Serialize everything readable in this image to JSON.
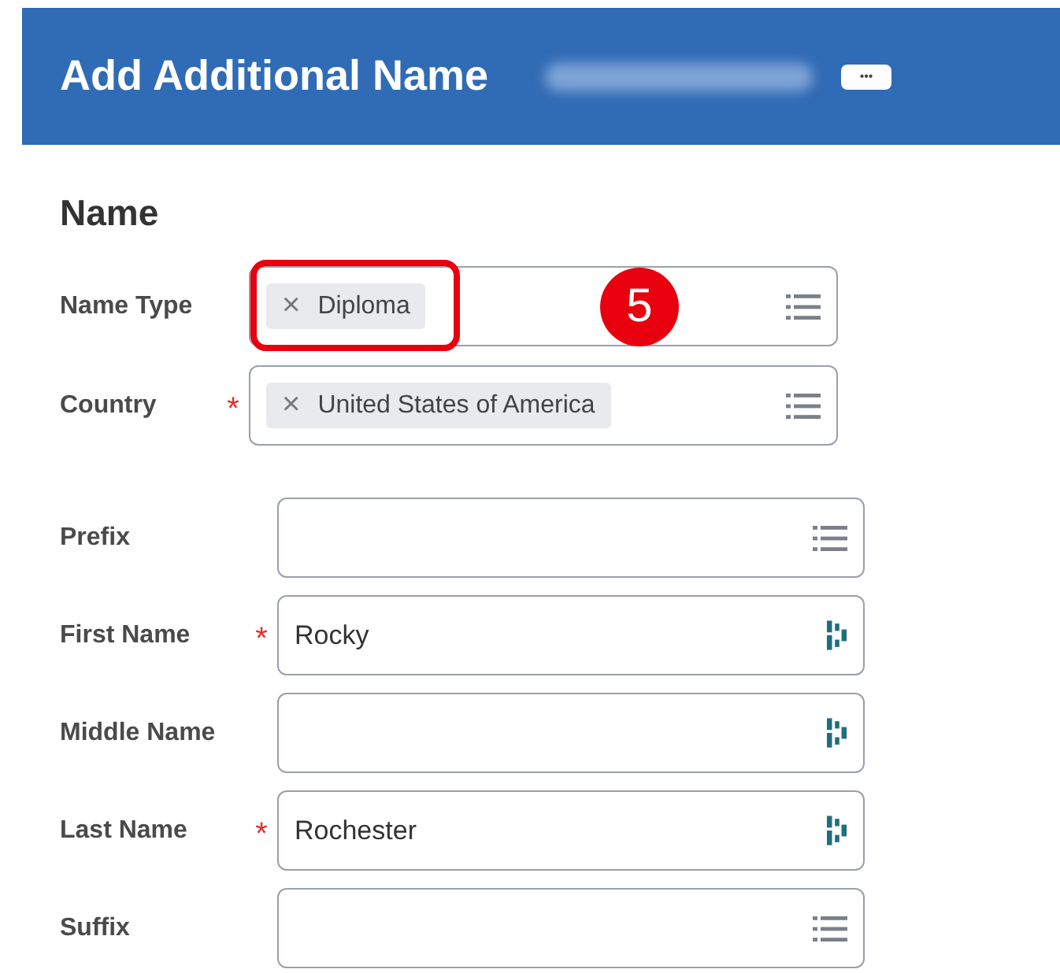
{
  "header": {
    "title": "Add Additional Name",
    "subtitle_redacted": true,
    "more_button": "•••"
  },
  "section_title": "Name",
  "field_groups": [
    [
      {
        "label": "Name Type",
        "kind": "select",
        "chips": [
          {
            "text": "Diploma",
            "remove": "×",
            "highlighted": true
          }
        ],
        "callout": "5"
      },
      {
        "label": "Country",
        "required_mark": "*",
        "kind": "select",
        "chips": [
          {
            "text": "United States of America",
            "remove": "×",
            "highlighted": false
          }
        ]
      }
    ],
    [
      {
        "label": "Prefix",
        "kind": "select"
      },
      {
        "label": "First Name",
        "required_mark": "*",
        "kind": "text",
        "value": "Rocky"
      },
      {
        "label": "Middle Name",
        "kind": "text"
      },
      {
        "label": "Last Name",
        "required_mark": "*",
        "kind": "text",
        "value": "Rochester"
      },
      {
        "label": "Suffix",
        "kind": "select"
      }
    ]
  ]
}
